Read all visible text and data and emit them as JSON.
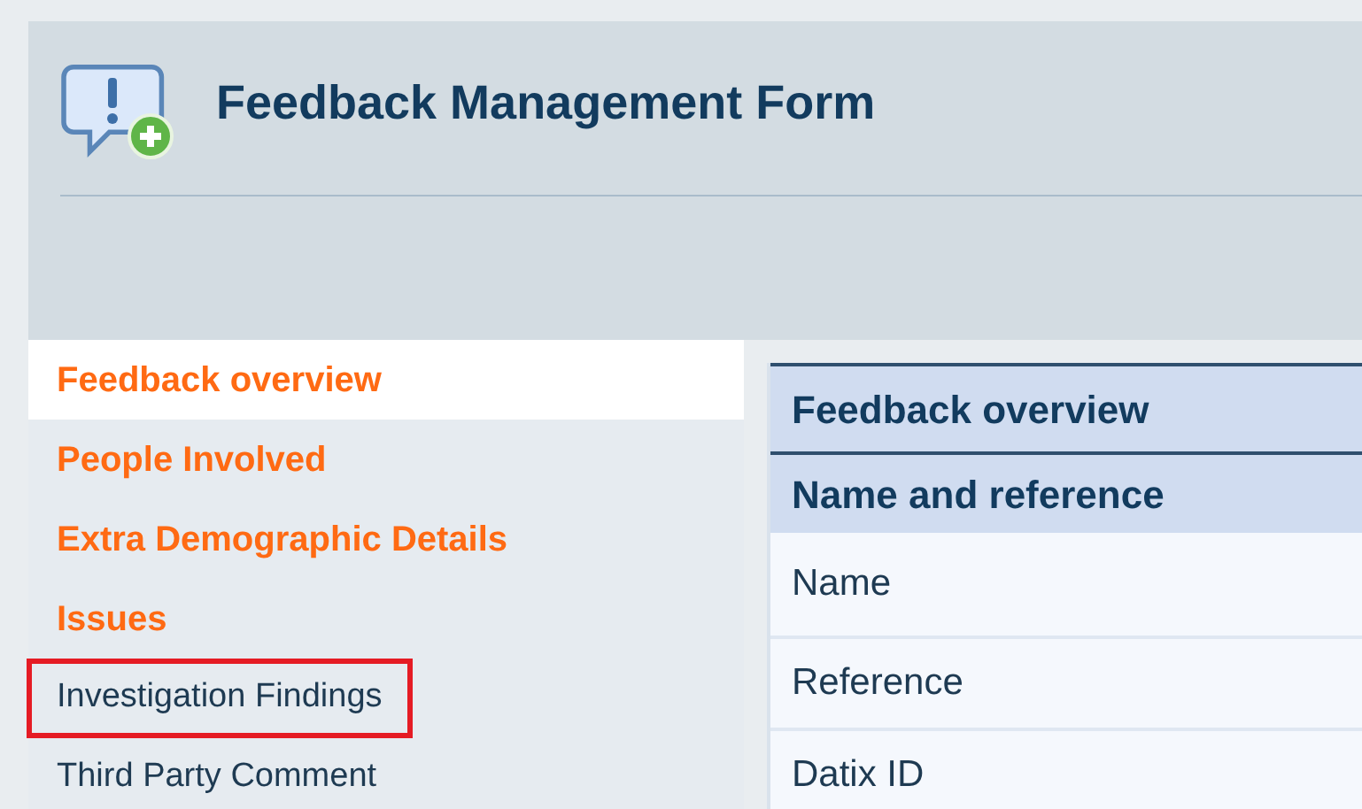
{
  "header": {
    "title": "Feedback Management Form"
  },
  "nav": {
    "items": [
      {
        "label": "Feedback overview",
        "kind": "highlighted",
        "selected": true,
        "outlined": false
      },
      {
        "label": "People Involved",
        "kind": "highlighted",
        "selected": false,
        "outlined": false
      },
      {
        "label": "Extra Demographic Details",
        "kind": "highlighted",
        "selected": false,
        "outlined": false
      },
      {
        "label": "Issues",
        "kind": "highlighted",
        "selected": false,
        "outlined": false
      },
      {
        "label": "Investigation Findings",
        "kind": "plain",
        "selected": false,
        "outlined": true
      },
      {
        "label": "Third Party Comment",
        "kind": "plain",
        "selected": false,
        "outlined": false
      }
    ]
  },
  "form": {
    "title": "Feedback overview",
    "section": "Name and reference",
    "fields": [
      {
        "label": "Name"
      },
      {
        "label": "Reference"
      },
      {
        "label": "Datix ID"
      }
    ]
  }
}
